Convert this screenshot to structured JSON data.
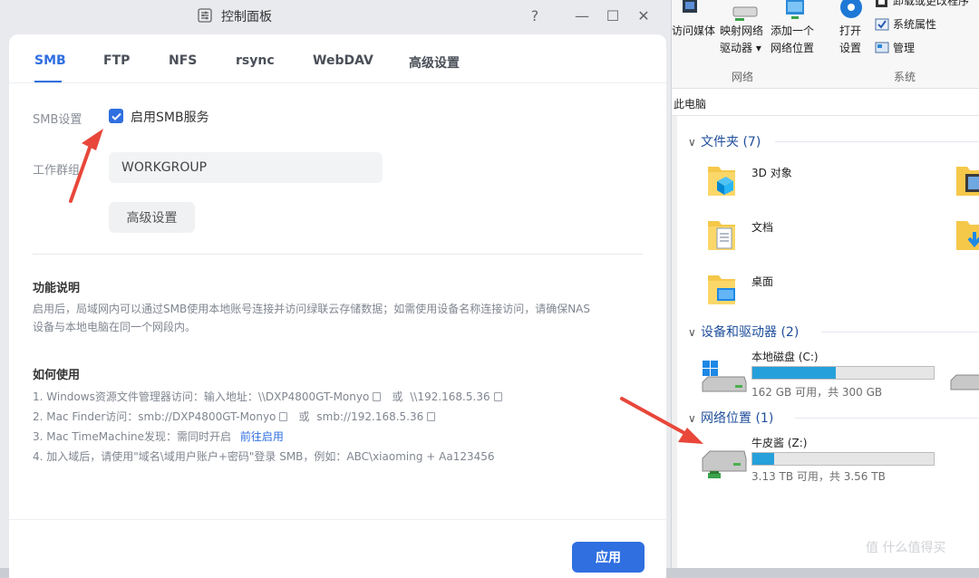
{
  "control_panel": {
    "title": "控制面板",
    "window_buttons": {
      "help": "?",
      "minimize": "—",
      "maximize": "☐",
      "close": "✕"
    },
    "tabs": [
      "SMB",
      "FTP",
      "NFS",
      "rsync",
      "WebDAV",
      "高级设置"
    ],
    "active_tab": "SMB",
    "smb_label": "SMB设置",
    "enable_smb": {
      "label": "启用SMB服务",
      "checked": true
    },
    "workgroup_label": "工作群组",
    "workgroup_value": "WORKGROUP",
    "advanced_button": "高级设置",
    "feature_title": "功能说明",
    "feature_desc_1": "启用后，局域网内可以通过SMB使用本地账号连接并访问绿联云存储数据；如需使用设备名称连接访问，请确保NAS",
    "feature_desc_2": "设备与本地电脑在同一个网段内。",
    "howto_title": "如何使用",
    "steps": {
      "s1a": "1. Windows资源文件管理器访问：输入地址：\\\\DXP4800GT-Monyo",
      "s1b": "或",
      "s1c": "\\\\192.168.5.36",
      "s2a": "2. Mac Finder访问：smb://DXP4800GT-Monyo",
      "s2b": "或",
      "s2c": "smb://192.168.5.36",
      "s3a": "3. Mac TimeMachine发现：需同时开启",
      "s3link": "前往启用",
      "s4": "4. 加入域后，请使用\"域名\\域用户账户+密码\"登录 SMB，例如：ABC\\xiaoming + Aa123456"
    },
    "apply_button": "应用",
    "accent_color": "#2f6fe0"
  },
  "explorer": {
    "ribbon": {
      "media_label": "访问媒体",
      "map_drive_1": "映射网络",
      "map_drive_2": "驱动器 ▾",
      "add_location_1": "添加一个",
      "add_location_2": "网络位置",
      "open_settings_1": "打开",
      "open_settings_2": "设置",
      "uninstall": "卸载或更改程序",
      "system_properties": "系统属性",
      "manage": "管理",
      "group_network": "网络",
      "group_system": "系统"
    },
    "address": "此电脑",
    "folders_group": "文件夹 (7)",
    "folders": [
      "3D 对象",
      "文档",
      "桌面"
    ],
    "devices_group": "设备和驱动器 (2)",
    "drive_c": {
      "name": "本地磁盘 (C:)",
      "info": "162 GB 可用，共 300 GB",
      "used_fraction": 0.46
    },
    "network_group": "网络位置 (1)",
    "drive_z": {
      "name": "牛皮酱 (Z:)",
      "info": "3.13 TB 可用，共 3.56 TB",
      "used_fraction": 0.12
    },
    "bar_color": "#26a0da"
  },
  "watermark": "值 什么值得买",
  "annotation_color": "#e8473a"
}
